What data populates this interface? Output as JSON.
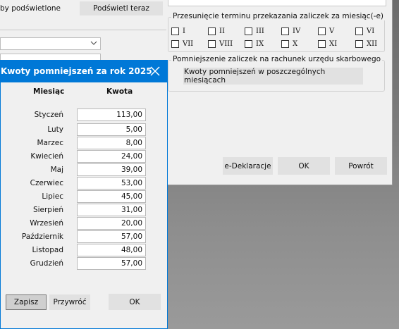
{
  "background_window": {
    "top_label": "by podświetlone",
    "highlight_button": "Podświetl teraz",
    "shift_group": {
      "title": "Przesunięcie terminu przekazania zaliczek za miesiąc(-e)",
      "months": [
        "I",
        "II",
        "III",
        "IV",
        "V",
        "VI",
        "VII",
        "VIII",
        "IX",
        "X",
        "XI",
        "XII"
      ]
    },
    "reduction_group": {
      "title": "Pomniejszenie zaliczek na rachunek urzędu skarbowego",
      "button": "Kwoty pomniejszeń w poszczególnych miesiącach"
    },
    "buttons": {
      "edeklaracje": "e-Deklaracje",
      "ok": "OK",
      "back": "Powrót"
    }
  },
  "dialog": {
    "title": "Kwoty pomniejszeń za rok 2025",
    "close_icon": "close-icon",
    "col_month": "Miesiąc",
    "col_amount": "Kwota",
    "rows": [
      {
        "month": "Styczeń",
        "amount": "113,00"
      },
      {
        "month": "Luty",
        "amount": "5,00"
      },
      {
        "month": "Marzec",
        "amount": "8,00"
      },
      {
        "month": "Kwiecień",
        "amount": "24,00"
      },
      {
        "month": "Maj",
        "amount": "39,00"
      },
      {
        "month": "Czerwiec",
        "amount": "53,00"
      },
      {
        "month": "Lipiec",
        "amount": "45,00"
      },
      {
        "month": "Sierpień",
        "amount": "31,00"
      },
      {
        "month": "Wrzesień",
        "amount": "20,00"
      },
      {
        "month": "Październik",
        "amount": "57,00"
      },
      {
        "month": "Listopad",
        "amount": "48,00"
      },
      {
        "month": "Grudzień",
        "amount": "57,00"
      }
    ],
    "buttons": {
      "save": "Zapisz",
      "restore": "Przywróć",
      "ok": "OK"
    }
  },
  "colors": {
    "titlebar": "#0078d7",
    "window_bg": "#f0f0f0",
    "button_bg": "#e1e1e1"
  }
}
